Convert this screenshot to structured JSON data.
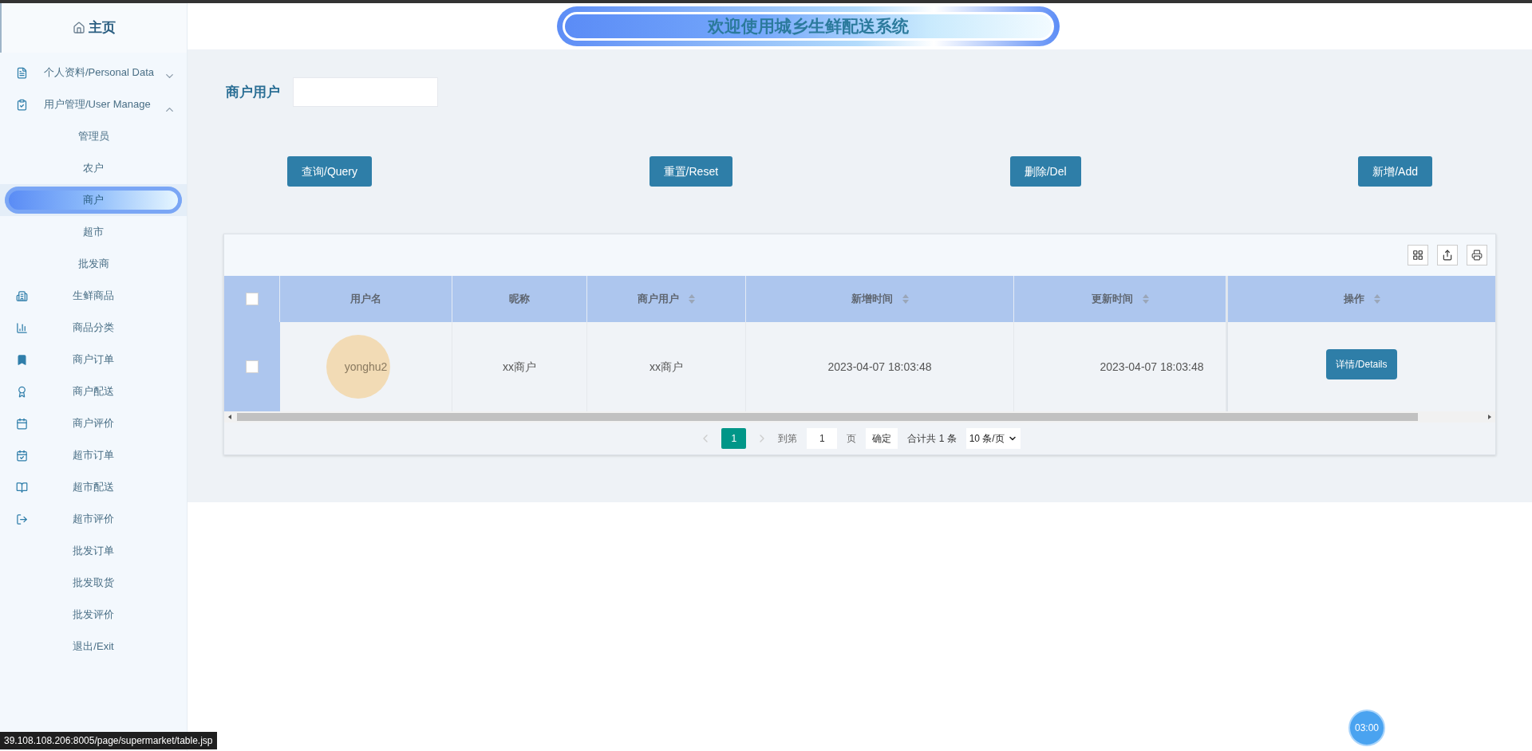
{
  "header": {
    "title": "欢迎使用城乡生鲜配送系统"
  },
  "sidebar": {
    "home": "主页",
    "items": [
      {
        "kind": "group",
        "label": "个人资料/Personal Data",
        "expanded": false
      },
      {
        "kind": "group",
        "label": "用户管理/User Manage",
        "expanded": true,
        "children": [
          {
            "label": "管理员",
            "selected": false
          },
          {
            "label": "农户",
            "selected": false
          },
          {
            "label": "商户",
            "selected": true
          },
          {
            "label": "超市",
            "selected": false
          },
          {
            "label": "批发商",
            "selected": false
          }
        ]
      },
      {
        "kind": "item",
        "label": "生鲜商品"
      },
      {
        "kind": "item",
        "label": "商品分类"
      },
      {
        "kind": "item",
        "label": "商户订单"
      },
      {
        "kind": "item",
        "label": "商户配送"
      },
      {
        "kind": "item",
        "label": "商户评价"
      },
      {
        "kind": "item",
        "label": "超市订单"
      },
      {
        "kind": "item",
        "label": "超市配送"
      },
      {
        "kind": "item",
        "label": "超市评价"
      },
      {
        "kind": "item",
        "label": "批发订单"
      },
      {
        "kind": "item",
        "label": "批发取货"
      },
      {
        "kind": "item",
        "label": "批发评价"
      },
      {
        "kind": "item",
        "label": "退出/Exit"
      }
    ]
  },
  "search": {
    "label": "商户用户"
  },
  "buttons": [
    "查询/Query",
    "重置/Reset",
    "删除/Del",
    "新增/Add"
  ],
  "table": {
    "select_all": false,
    "columns": [
      {
        "label": "用户名",
        "sortable": false
      },
      {
        "label": "昵称",
        "sortable": false
      },
      {
        "label": "商户用户",
        "sortable": true
      },
      {
        "label": "新增时间",
        "sortable": true
      },
      {
        "label": "更新时间",
        "sortable": true
      }
    ],
    "action_column": {
      "label": "操作",
      "sortable": true
    },
    "rows": [
      {
        "checked": false,
        "cells": [
          "yonghu2",
          "xx商户",
          "xx商户",
          "2023-04-07 18:03:48",
          "2023-04-07 18:03:48"
        ],
        "action": "详情/Details"
      }
    ]
  },
  "pagination": {
    "pages": [
      {
        "label": "1",
        "selected": true
      }
    ],
    "goto_label": "到第",
    "goto_value": "1",
    "page_unit": "页",
    "confirm": "确定",
    "total": "合计共 1 条",
    "page_size": "10 条/页"
  },
  "status_url": "39.108.108.206:8005/page/supermarket/table.jsp",
  "timer": "03:00"
}
